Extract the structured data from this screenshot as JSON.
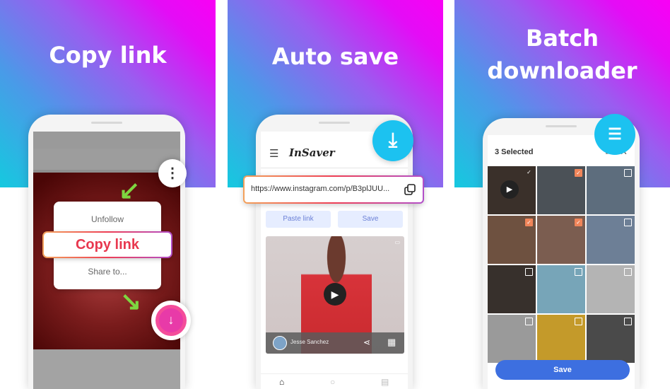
{
  "panels": [
    {
      "headline": "Copy link",
      "phone": {
        "menu": [
          "Unfollow",
          "Copy link",
          "Share to..."
        ],
        "more_icon": "more-vertical-icon",
        "download_icon": "download-circle-icon"
      }
    },
    {
      "headline": "Auto save",
      "phone": {
        "app_name": "InSaver",
        "url": "https://www.instagram.com/p/B3plJUU...",
        "paste_label": "Paste link",
        "save_label": "Save",
        "video_author": "Jesse Sanchez",
        "nav": [
          "home-icon",
          "search-icon",
          "downloads-icon"
        ]
      }
    },
    {
      "headline_lines": [
        "Batch",
        "downloader"
      ],
      "phone": {
        "selected_label": "3 Selected",
        "save_label": "Save",
        "cells": [
          {
            "checked": "plain",
            "color": "#3a302a",
            "video": true
          },
          {
            "checked": "on",
            "color": "#4b5157"
          },
          {
            "checked": "off",
            "color": "#5d6d7d"
          },
          {
            "checked": "on",
            "color": "#6e5140"
          },
          {
            "checked": "on",
            "color": "#7b5d50"
          },
          {
            "checked": "off",
            "color": "#6d7f96"
          },
          {
            "checked": "off",
            "color": "#37302c"
          },
          {
            "checked": "off",
            "color": "#77a5b8"
          },
          {
            "checked": "off",
            "color": "#b4b4b4"
          },
          {
            "checked": "off",
            "color": "#9a9a9a"
          },
          {
            "checked": "off",
            "color": "#c49a2a"
          },
          {
            "checked": "off",
            "color": "#4a4a4a"
          }
        ]
      }
    }
  ]
}
